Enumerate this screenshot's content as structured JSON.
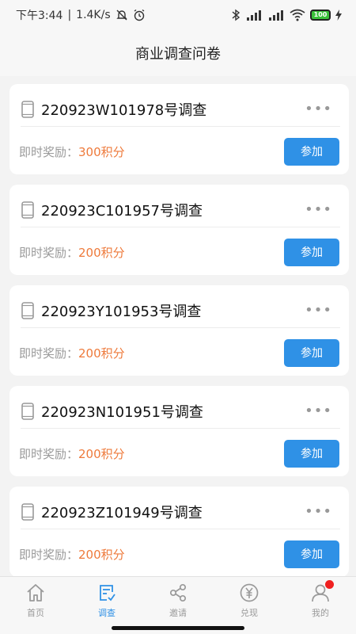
{
  "status_bar": {
    "time": "下午3:44",
    "net_speed": "1.4K/s",
    "battery": "100"
  },
  "header": {
    "title": "商业调查问卷"
  },
  "surveys": [
    {
      "title": "220923W101978号调查",
      "reward_label": "即时奖励：",
      "reward_value": "300积分",
      "button": "参加"
    },
    {
      "title": "220923C101957号调查",
      "reward_label": "即时奖励：",
      "reward_value": "200积分",
      "button": "参加"
    },
    {
      "title": "220923Y101953号调查",
      "reward_label": "即时奖励：",
      "reward_value": "200积分",
      "button": "参加"
    },
    {
      "title": "220923N101951号调查",
      "reward_label": "即时奖励：",
      "reward_value": "200积分",
      "button": "参加"
    },
    {
      "title": "220923Z101949号调查",
      "reward_label": "即时奖励：",
      "reward_value": "200积分",
      "button": "参加"
    }
  ],
  "tabbar": {
    "items": [
      {
        "label": "首页",
        "icon": "home-icon"
      },
      {
        "label": "调查",
        "icon": "survey-icon",
        "active": true
      },
      {
        "label": "邀请",
        "icon": "share-icon"
      },
      {
        "label": "兑现",
        "icon": "yuan-icon"
      },
      {
        "label": "我的",
        "icon": "user-icon",
        "badge": true
      }
    ]
  },
  "colors": {
    "accent": "#2f91e6",
    "reward": "#ee7a3b",
    "badge": "#f02020"
  }
}
